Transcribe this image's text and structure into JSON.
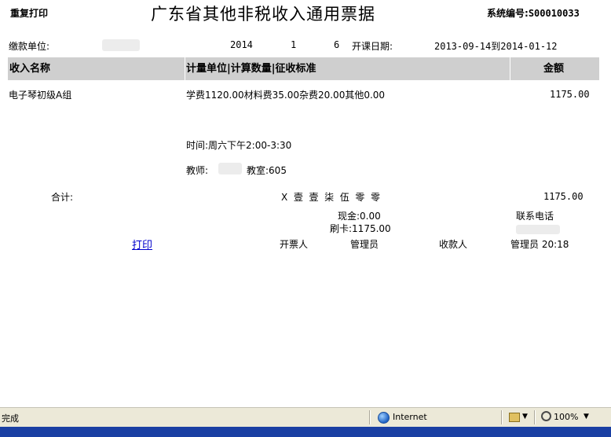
{
  "header": {
    "reprint_label": "重复打印",
    "title": "广东省其他非税收入通用票据",
    "system_no_label": "系统编号:",
    "system_no": "S00010033"
  },
  "info": {
    "payer_label": "缴款单位:",
    "year": "2014",
    "num1": "1",
    "num2": "6",
    "open_date_label": "开课日期:",
    "date_range": "2013-09-14到2014-01-12"
  },
  "table": {
    "headers": [
      "收入名称",
      "计量单位|计算数量|征收标准",
      "金额"
    ],
    "row": {
      "name": "电子琴初级A组",
      "detail": "学费1120.00材料费35.00杂费20.00其他0.00",
      "amount": "1175.00"
    }
  },
  "schedule": {
    "time": "时间:周六下午2:00-3:30",
    "teacher_label": "教师:",
    "classroom": "教室:605"
  },
  "total": {
    "label": "合计:",
    "chinese_amount": "X  壹  壹  柒  伍  零  零",
    "amount": "1175.00"
  },
  "payment": {
    "cash": "现金:0.00",
    "card": "刷卡:1175.00",
    "contact_label": "联系电话"
  },
  "footer": {
    "print_link": "打印",
    "issuer": "开票人",
    "admin1": "管理员",
    "receiver": "收款人",
    "admin2": "管理员 20:18"
  },
  "statusbar": {
    "status": "完成",
    "zone": "Internet",
    "zoom": "100%"
  }
}
